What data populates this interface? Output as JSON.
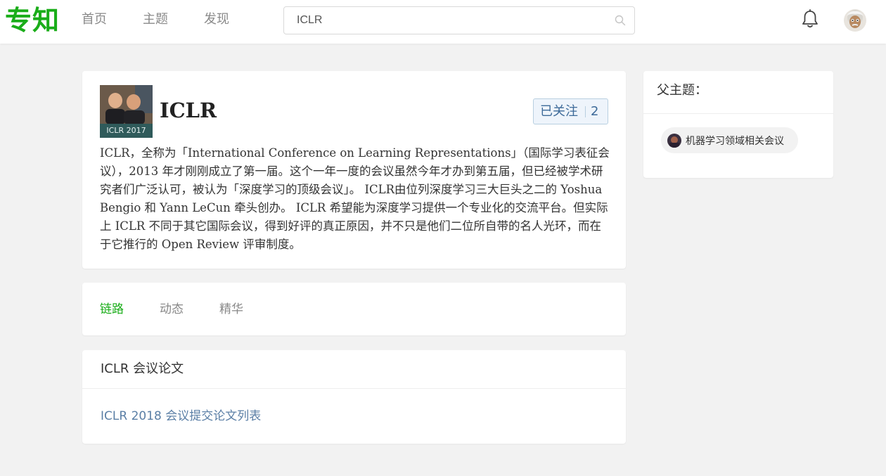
{
  "header": {
    "logo": "专知",
    "nav": [
      "首页",
      "主题",
      "发现"
    ],
    "search_value": "ICLR"
  },
  "topic": {
    "thumb_caption": "ICLR 2017",
    "title": "ICLR",
    "follow_label": "已关注",
    "follow_count": "2",
    "description": "ICLR，全称为「International Conference on Learning Representations」（国际学习表征会议），2013 年才刚刚成立了第一届。这个一年一度的会议虽然今年才办到第五届，但已经被学术研究者们广泛认可，被认为「深度学习的顶级会议」。 ICLR由位列深度学习三大巨头之二的 Yoshua Bengio 和 Yann LeCun 牵头创办。 ICLR 希望能为深度学习提供一个专业化的交流平台。但实际上 ICLR 不同于其它国际会议，得到好评的真正原因，并不只是他们二位所自带的名人光环，而在于它推行的 Open Review 评审制度。"
  },
  "tabs": [
    {
      "label": "链路",
      "active": true
    },
    {
      "label": "动态",
      "active": false
    },
    {
      "label": "精华",
      "active": false
    }
  ],
  "papers": {
    "title": "ICLR 会议论文",
    "link": "ICLR 2018 会议提交论文列表"
  },
  "parent": {
    "title": "父主题：",
    "chip_label": "机器学习领域相关会议"
  },
  "colors": {
    "brand_green": "#1aad19",
    "link_blue": "#5b7fa6",
    "follow_blue": "#3d6a99"
  }
}
